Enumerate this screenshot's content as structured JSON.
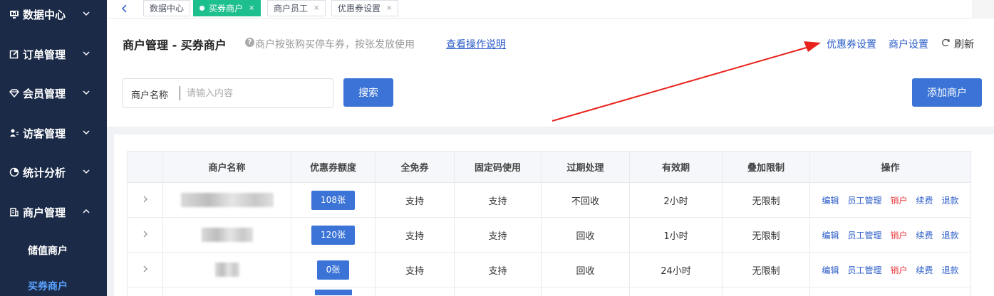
{
  "sidebar": {
    "items": [
      {
        "label": "数据中心",
        "icon": "monitor-icon",
        "expanded": false
      },
      {
        "label": "订单管理",
        "icon": "edit-icon",
        "expanded": false
      },
      {
        "label": "会员管理",
        "icon": "diamond-icon",
        "expanded": false
      },
      {
        "label": "访客管理",
        "icon": "visitor-icon",
        "expanded": false
      },
      {
        "label": "统计分析",
        "icon": "pie-chart-icon",
        "expanded": false
      },
      {
        "label": "商户管理",
        "icon": "building-icon",
        "expanded": true
      }
    ],
    "sub_items": [
      {
        "label": "储值商户",
        "active": false
      },
      {
        "label": "买券商户",
        "active": true
      }
    ]
  },
  "tabs": [
    {
      "label": "数据中心",
      "active": false,
      "closable": false
    },
    {
      "label": "买券商户",
      "active": true,
      "closable": true
    },
    {
      "label": "商户员工",
      "active": false,
      "closable": true
    },
    {
      "label": "优惠券设置",
      "active": false,
      "closable": true
    }
  ],
  "tab_close_glyph": "×",
  "header": {
    "title": "商户管理 - 买券商户",
    "help_glyph": "?",
    "help_text": "商户按张购买停车券，按张发放使用",
    "help_link": "查看操作说明",
    "links": {
      "coupon_settings": "优惠券设置",
      "merchant_settings": "商户设置",
      "refresh": "刷新"
    }
  },
  "search": {
    "label": "商户名称",
    "placeholder": "请输入内容",
    "value": "",
    "button": "搜索"
  },
  "add_button": "添加商户",
  "table": {
    "columns": [
      "",
      "商户名称",
      "优惠券额度",
      "全免券",
      "固定码使用",
      "过期处理",
      "有效期",
      "叠加限制",
      "操作"
    ],
    "rows": [
      {
        "name_hidden": true,
        "quota": "108张",
        "free_coupon": "支持",
        "fixed_code": "支持",
        "expire": "不回收",
        "validity": "2小时",
        "stack": "无限制"
      },
      {
        "name_hidden": true,
        "quota": "120张",
        "free_coupon": "支持",
        "fixed_code": "支持",
        "expire": "回收",
        "validity": "1小时",
        "stack": "无限制"
      },
      {
        "name_hidden": true,
        "quota": "0张",
        "free_coupon": "支持",
        "fixed_code": "支持",
        "expire": "回收",
        "validity": "24小时",
        "stack": "无限制"
      }
    ],
    "actions": [
      "编辑",
      "员工管理",
      "销户",
      "续费",
      "退款"
    ]
  },
  "colors": {
    "sidebar_bg": "#1b2a47",
    "active_submenu": "#5aa2ff",
    "active_tab": "#1dbf8e",
    "primary_button": "#3b74d6",
    "link": "#2b5cc8",
    "danger": "#e8383d",
    "annotation_arrow": "#e8231d"
  }
}
